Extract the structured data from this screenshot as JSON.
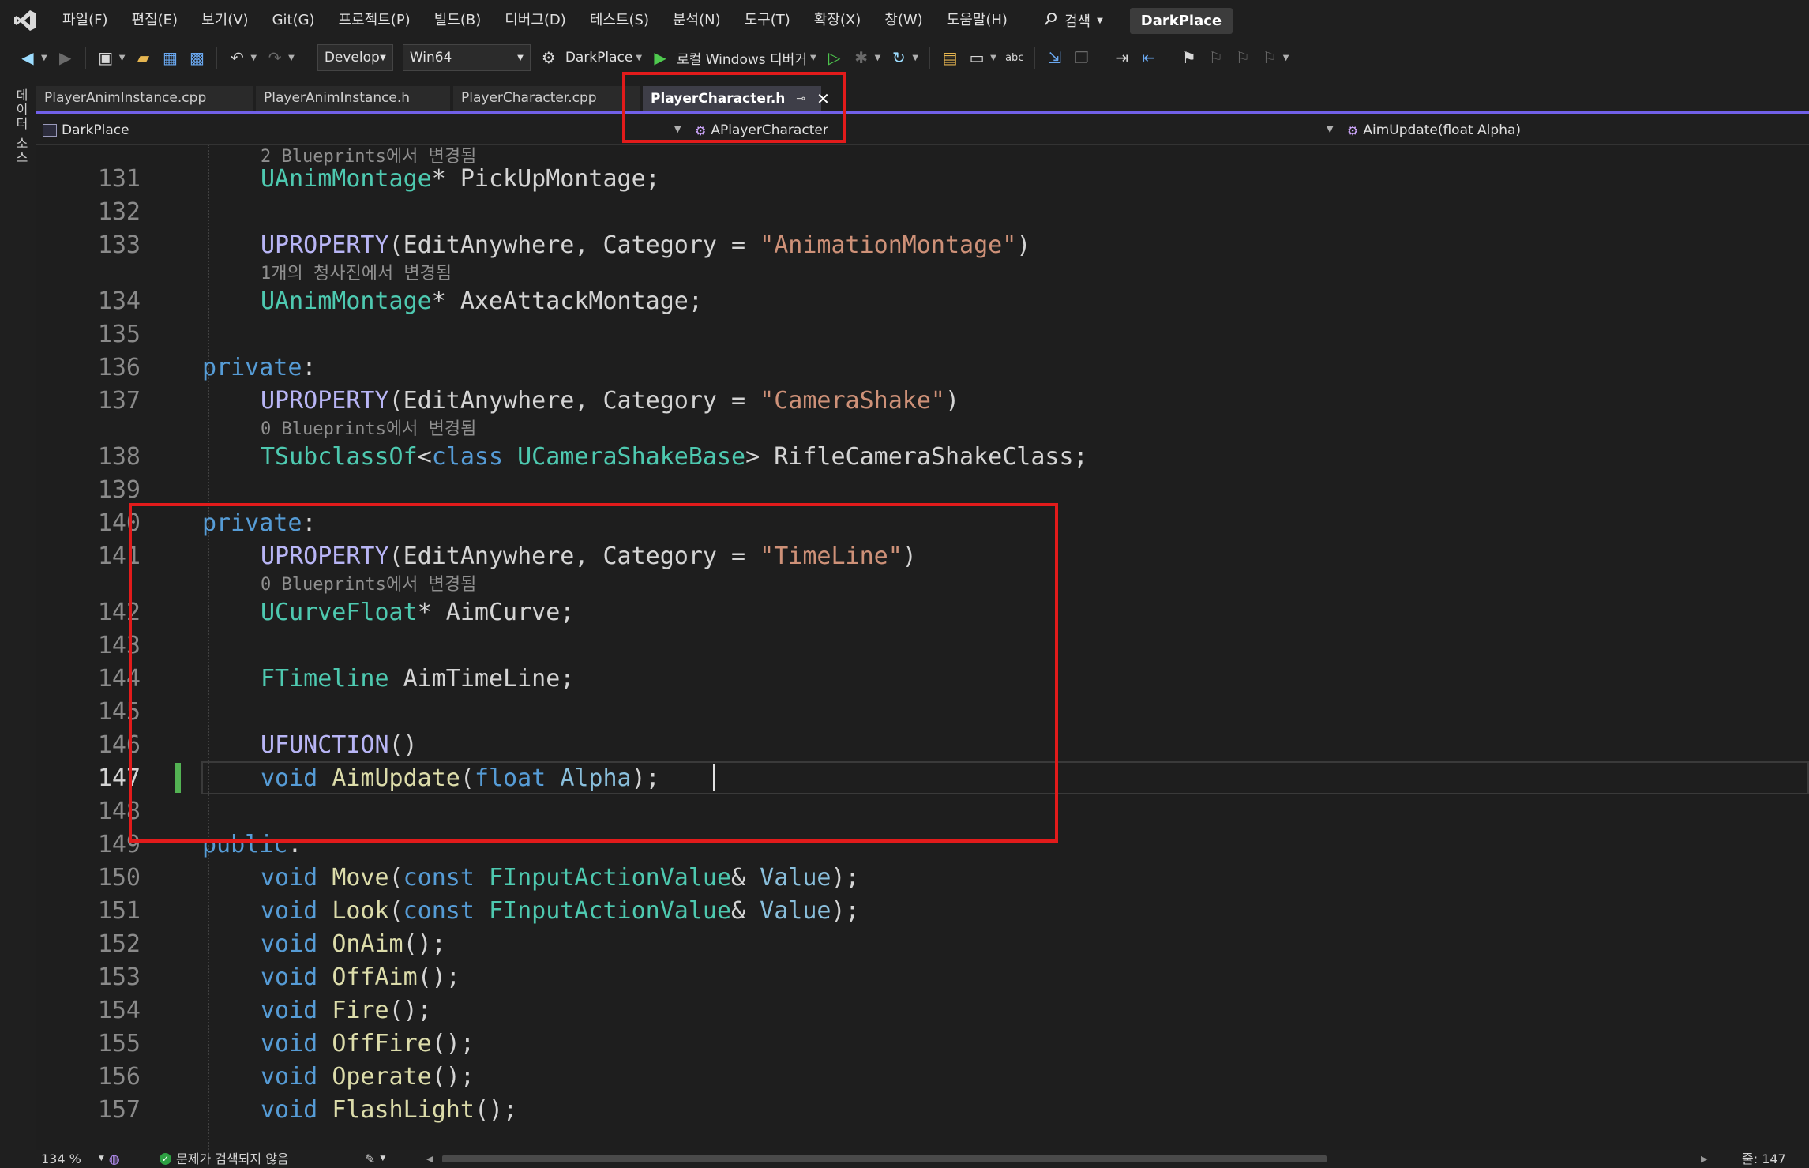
{
  "menubar": {
    "items": [
      "파일(F)",
      "편집(E)",
      "보기(V)",
      "Git(G)",
      "프로젝트(P)",
      "빌드(B)",
      "디버그(D)",
      "테스트(S)",
      "분석(N)",
      "도구(T)",
      "확장(X)",
      "창(W)",
      "도움말(H)"
    ],
    "search_label": "검색",
    "solution_name": "DarkPlace"
  },
  "toolbar": {
    "configuration": "Develop",
    "platform": "Win64",
    "startup_project": "DarkPlace",
    "debugger_label": "로컬 Windows 디버거"
  },
  "side_panel": {
    "label": "데이터 소스"
  },
  "tabs": [
    {
      "label": "PlayerAnimInstance.cpp",
      "active": false
    },
    {
      "label": "PlayerAnimInstance.h",
      "active": false
    },
    {
      "label": "PlayerCharacter.cpp",
      "active": false
    },
    {
      "label": "PlayerCharacter.h",
      "active": true
    }
  ],
  "navbar": {
    "project": "DarkPlace",
    "scope": "APlayerCharacter",
    "member": "AimUpdate(float Alpha)"
  },
  "editor": {
    "top_partial_lens": "2 Blueprints에서 변경됨",
    "lines": [
      {
        "num": "131",
        "tokens": [
          [
            "type",
            "UAnimMontage"
          ],
          [
            "punc",
            "* PickUpMontage;"
          ]
        ]
      },
      {
        "num": "132",
        "tokens": []
      },
      {
        "num": "133",
        "tokens": [
          [
            "macro",
            "UPROPERTY"
          ],
          [
            "punc",
            "(EditAnywhere, Category = "
          ],
          [
            "str",
            "\"AnimationMontage\""
          ],
          [
            "punc",
            ")"
          ]
        ],
        "lens": "1개의 청사진에서 변경됨"
      },
      {
        "num": "134",
        "tokens": [
          [
            "type",
            "UAnimMontage"
          ],
          [
            "punc",
            "* AxeAttackMontage;"
          ]
        ]
      },
      {
        "num": "135",
        "tokens": []
      },
      {
        "num": "136",
        "tokens": [
          [
            "kw",
            "private"
          ],
          [
            "punc",
            ":"
          ]
        ],
        "outdent": true
      },
      {
        "num": "137",
        "tokens": [
          [
            "macro",
            "UPROPERTY"
          ],
          [
            "punc",
            "(EditAnywhere, Category = "
          ],
          [
            "str",
            "\"CameraShake\""
          ],
          [
            "punc",
            ")"
          ]
        ],
        "lens": "0 Blueprints에서 변경됨"
      },
      {
        "num": "138",
        "tokens": [
          [
            "type",
            "TSubclassOf"
          ],
          [
            "punc",
            "<"
          ],
          [
            "kw",
            "class "
          ],
          [
            "type",
            "UCameraShakeBase"
          ],
          [
            "punc",
            "> RifleCameraShakeClass;"
          ]
        ]
      },
      {
        "num": "139",
        "tokens": []
      },
      {
        "num": "140",
        "tokens": [
          [
            "kw",
            "private"
          ],
          [
            "punc",
            ":"
          ]
        ],
        "outdent": true
      },
      {
        "num": "141",
        "tokens": [
          [
            "macro",
            "UPROPERTY"
          ],
          [
            "punc",
            "(EditAnywhere, Category = "
          ],
          [
            "str",
            "\"TimeLine\""
          ],
          [
            "punc",
            ")"
          ]
        ],
        "lens": "0 Blueprints에서 변경됨"
      },
      {
        "num": "142",
        "tokens": [
          [
            "type",
            "UCurveFloat"
          ],
          [
            "punc",
            "* AimCurve;"
          ]
        ]
      },
      {
        "num": "143",
        "tokens": []
      },
      {
        "num": "144",
        "tokens": [
          [
            "type",
            "FTimeline"
          ],
          [
            "punc",
            " AimTimeLine;"
          ]
        ]
      },
      {
        "num": "145",
        "tokens": []
      },
      {
        "num": "146",
        "tokens": [
          [
            "macro",
            "UFUNCTION"
          ],
          [
            "punc",
            "()"
          ]
        ]
      },
      {
        "num": "147",
        "tokens": [
          [
            "kw",
            "void "
          ],
          [
            "fn",
            "AimUpdate"
          ],
          [
            "punc",
            "("
          ],
          [
            "kw",
            "float "
          ],
          [
            "param",
            "Alpha"
          ],
          [
            "punc",
            ");"
          ]
        ],
        "current": true
      },
      {
        "num": "148",
        "tokens": []
      },
      {
        "num": "149",
        "tokens": [
          [
            "kw",
            "public"
          ],
          [
            "punc",
            ":"
          ]
        ],
        "outdent": true
      },
      {
        "num": "150",
        "tokens": [
          [
            "kw",
            "void "
          ],
          [
            "fn",
            "Move"
          ],
          [
            "punc",
            "("
          ],
          [
            "kw",
            "const "
          ],
          [
            "type",
            "FInputActionValue"
          ],
          [
            "punc",
            "& "
          ],
          [
            "param",
            "Value"
          ],
          [
            "punc",
            ");"
          ]
        ]
      },
      {
        "num": "151",
        "tokens": [
          [
            "kw",
            "void "
          ],
          [
            "fn",
            "Look"
          ],
          [
            "punc",
            "("
          ],
          [
            "kw",
            "const "
          ],
          [
            "type",
            "FInputActionValue"
          ],
          [
            "punc",
            "& "
          ],
          [
            "param",
            "Value"
          ],
          [
            "punc",
            ");"
          ]
        ]
      },
      {
        "num": "152",
        "tokens": [
          [
            "kw",
            "void "
          ],
          [
            "fn",
            "OnAim"
          ],
          [
            "punc",
            "();"
          ]
        ]
      },
      {
        "num": "153",
        "tokens": [
          [
            "kw",
            "void "
          ],
          [
            "fn",
            "OffAim"
          ],
          [
            "punc",
            "();"
          ]
        ]
      },
      {
        "num": "154",
        "tokens": [
          [
            "kw",
            "void "
          ],
          [
            "fn",
            "Fire"
          ],
          [
            "punc",
            "();"
          ]
        ]
      },
      {
        "num": "155",
        "tokens": [
          [
            "kw",
            "void "
          ],
          [
            "fn",
            "OffFire"
          ],
          [
            "punc",
            "();"
          ]
        ]
      },
      {
        "num": "156",
        "tokens": [
          [
            "kw",
            "void "
          ],
          [
            "fn",
            "Operate"
          ],
          [
            "punc",
            "();"
          ]
        ]
      },
      {
        "num": "157",
        "tokens": [
          [
            "kw",
            "void "
          ],
          [
            "fn",
            "FlashLight"
          ],
          [
            "punc",
            "();"
          ]
        ]
      }
    ]
  },
  "statusbar": {
    "zoom": "134 %",
    "issues": "문제가 검색되지 않음",
    "line_indicator": "줄: 147"
  },
  "colors": {
    "keyword": "#569cd6",
    "type": "#4ec9b0",
    "macro": "#b8b5f5",
    "function": "#dcdcaa",
    "string": "#ce9178",
    "highlight_box": "#e21b1b",
    "tab_accent": "#7160e8"
  }
}
